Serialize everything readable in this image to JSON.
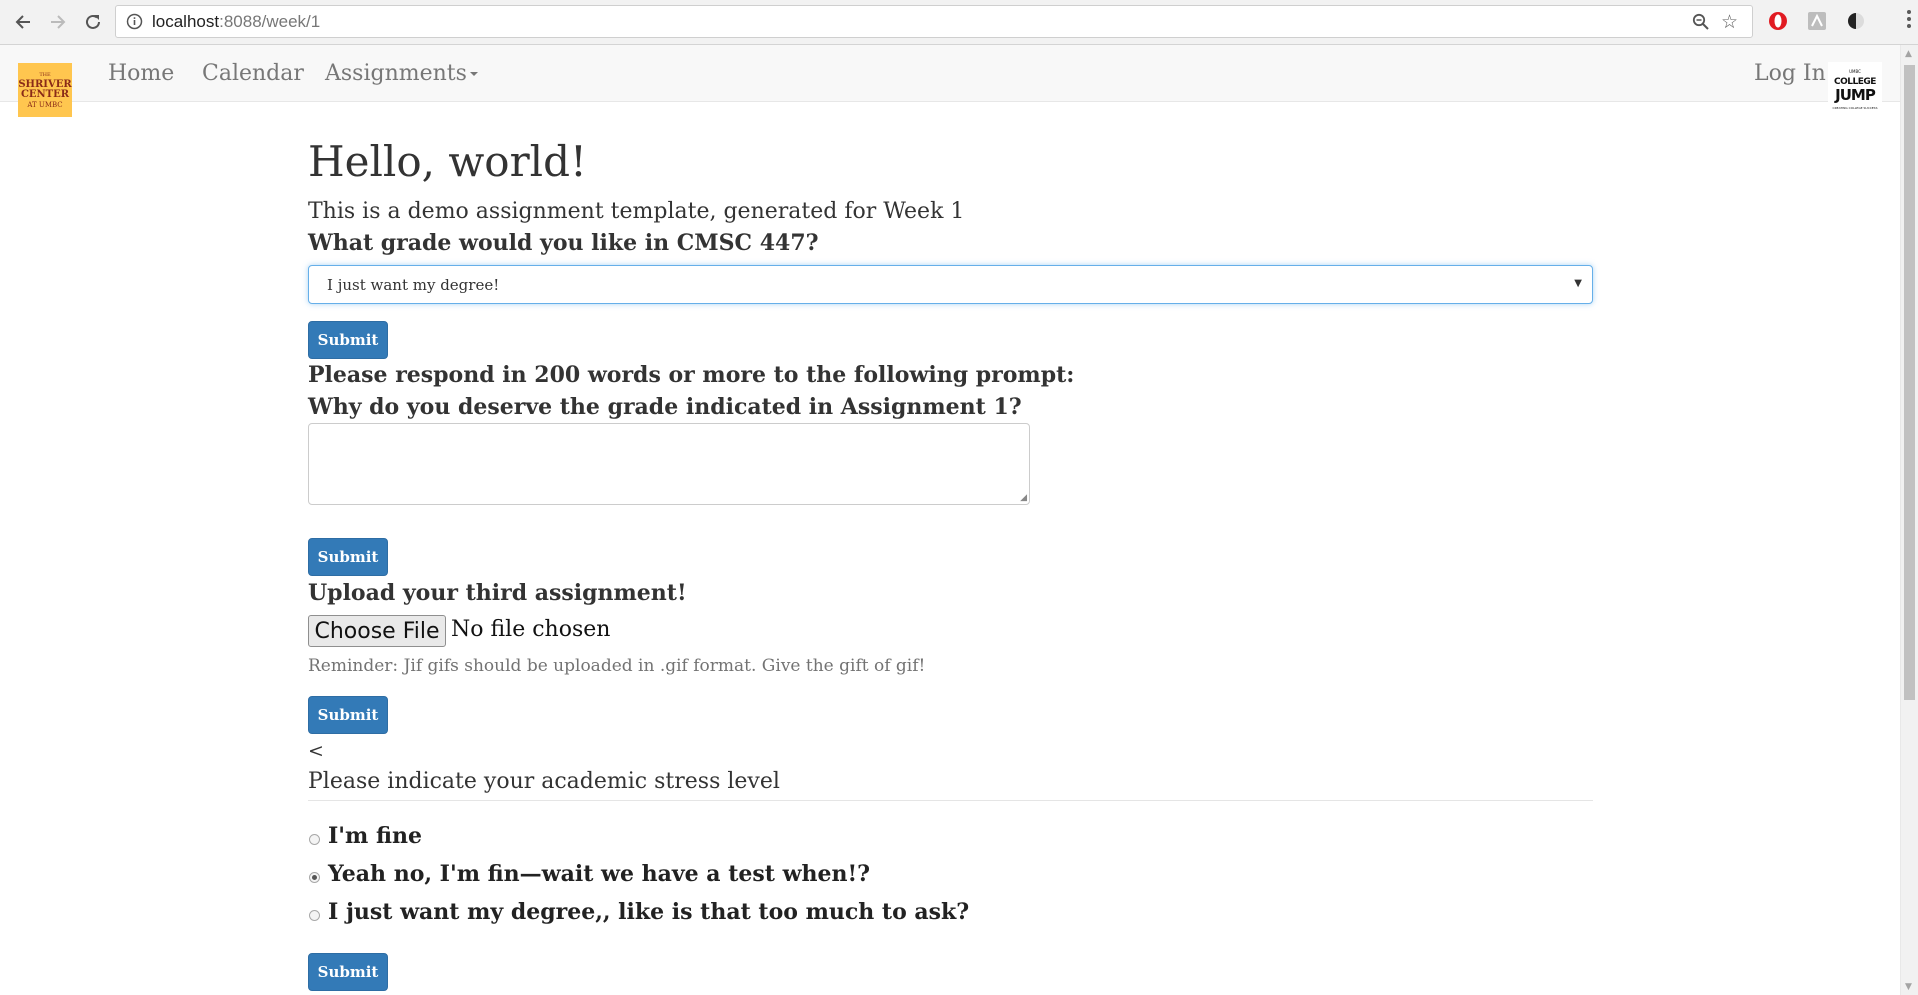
{
  "browser": {
    "url_host": "localhost",
    "url_rest": ":8088/week/1"
  },
  "navbar": {
    "logo_left": {
      "line1": "THE",
      "line2": "SHRIVER",
      "line3": "CENTER",
      "line4": "AT UMBC"
    },
    "links": [
      "Home",
      "Calendar",
      "Assignments"
    ],
    "login": "Log In",
    "logo_right": {
      "line1": "UMBC",
      "line2": "COLLEGE",
      "line3": "JUMP",
      "line4": "CREATING COLLEGE SUCCESS"
    }
  },
  "page": {
    "title": "Hello, world!",
    "lead": "This is a demo assignment template, generated for Week 1"
  },
  "assignment1": {
    "question": "What grade would you like in CMSC 447?",
    "selected": "I just want my degree!",
    "submit": "Submit"
  },
  "assignment2": {
    "question_line1": "Please respond in 200 words or more to the following prompt:",
    "question_line2": "Why do you deserve the grade indicated in Assignment 1?",
    "submit": "Submit"
  },
  "assignment3": {
    "question": "Upload your third assignment!",
    "file_button": "Choose File",
    "file_status": "No file chosen",
    "help": "Reminder: Jif gifs should be uploaded in .gif format. Give the gift of gif!",
    "submit": "Submit"
  },
  "stray_text": "<",
  "assignment4": {
    "legend": "Please indicate your academic stress level",
    "options": [
      {
        "label": "I'm fine",
        "checked": false
      },
      {
        "label": "Yeah no, I'm fin—wait we have a test when!?",
        "checked": true
      },
      {
        "label": "I just want my degree,, like is that too much to ask?",
        "checked": false
      }
    ],
    "submit": "Submit"
  },
  "colors": {
    "primary_button": "#337ab7",
    "focus_border": "#66afe9",
    "logo_left_bg": "#ffc64f"
  }
}
